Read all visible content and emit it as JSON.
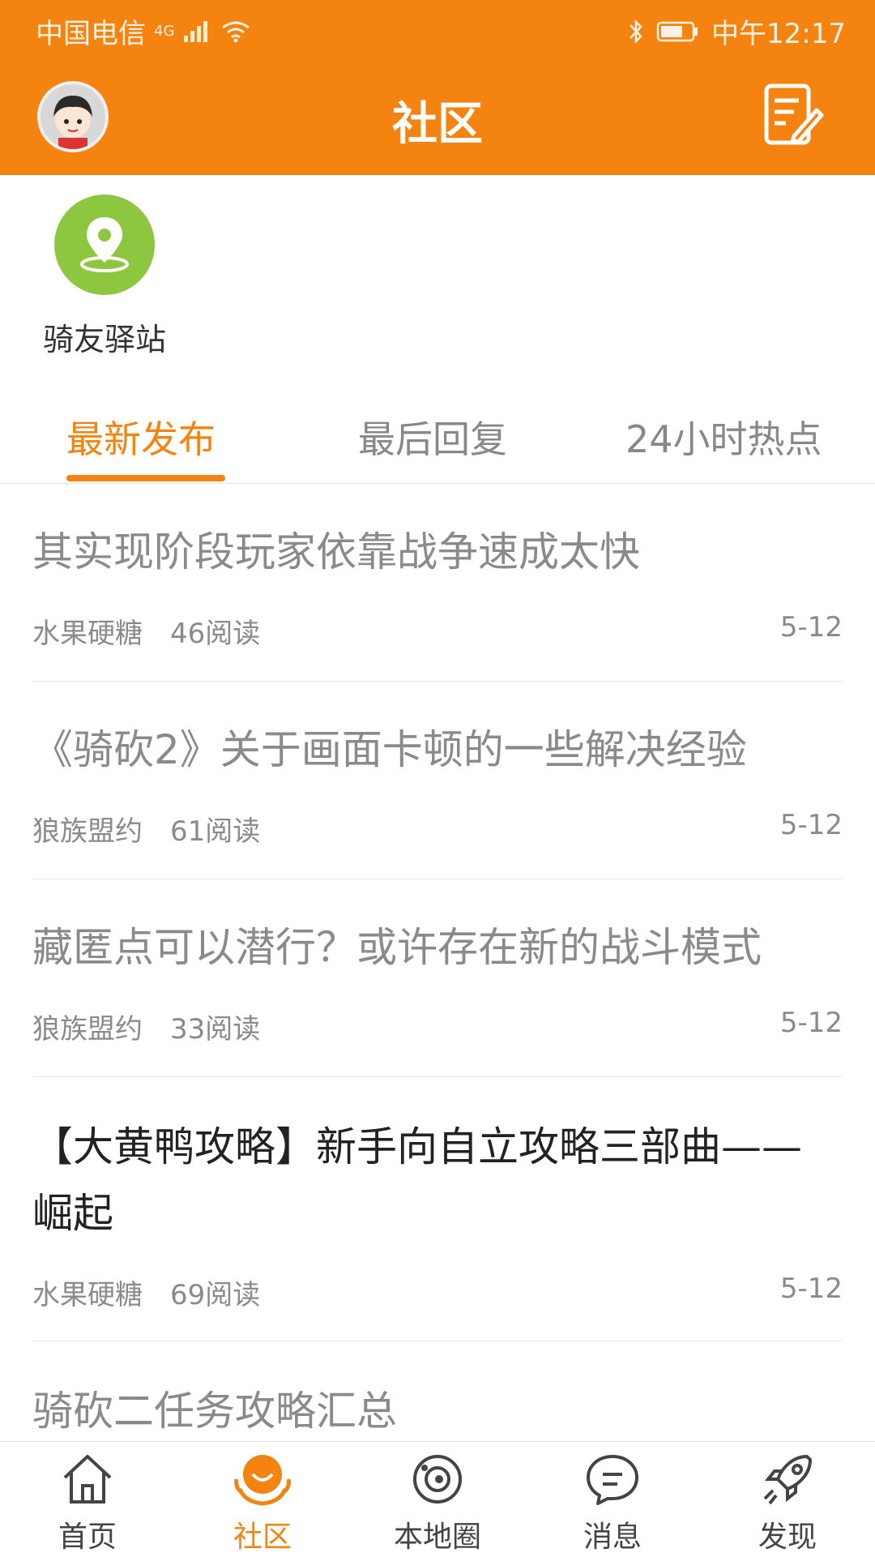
{
  "status_bar": {
    "carrier": "中国电信",
    "network": "4G",
    "time": "中午12:17"
  },
  "header": {
    "title": "社区",
    "avatar_icon": "avatar",
    "compose_icon": "compose-icon"
  },
  "shortcuts": [
    {
      "label": "骑友驿站",
      "icon": "location-pin-icon",
      "color": "#8DC63F"
    }
  ],
  "tabs": [
    {
      "label": "最新发布",
      "active": true
    },
    {
      "label": "最后回复",
      "active": false
    },
    {
      "label": "24小时热点",
      "active": false
    }
  ],
  "posts": [
    {
      "title": "其实现阶段玩家依靠战争速成太快",
      "author": "水果硬糖",
      "reads": "46阅读",
      "date": "5-12"
    },
    {
      "title": "《骑砍2》关于画面卡顿的一些解决经验",
      "author": "狼族盟约",
      "reads": "61阅读",
      "date": "5-12"
    },
    {
      "title": "藏匿点可以潜行？或许存在新的战斗模式",
      "author": "狼族盟约",
      "reads": "33阅读",
      "date": "5-12"
    },
    {
      "title_line1": "【大黄鸭攻略】新手向自立攻略三部曲——",
      "title_line2": "崛起",
      "author": "水果硬糖",
      "reads": "69阅读",
      "date": "5-12"
    },
    {
      "title": "骑砍二任务攻略汇总"
    }
  ],
  "bottom_nav": [
    {
      "label": "首页",
      "icon": "home-icon",
      "active": false
    },
    {
      "label": "社区",
      "icon": "community-icon",
      "active": true
    },
    {
      "label": "本地圈",
      "icon": "local-circle-icon",
      "active": false
    },
    {
      "label": "消息",
      "icon": "message-icon",
      "active": false
    },
    {
      "label": "发现",
      "icon": "rocket-icon",
      "active": false
    }
  ],
  "colors": {
    "accent": "#F5830F",
    "station_green": "#8DC63F"
  }
}
